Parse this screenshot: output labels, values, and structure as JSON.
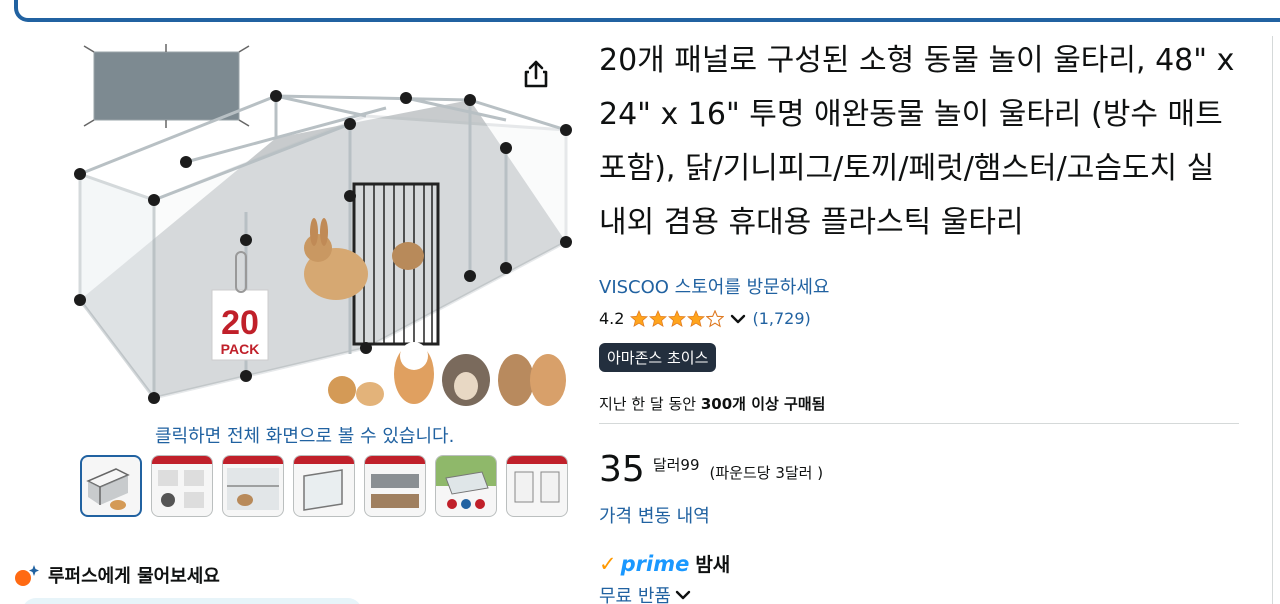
{
  "product": {
    "title": "20개 패널로 구성된 소형 동물 놀이 울타리, 48\" x 24\" x 16\" 투명 애완동물 놀이 울타리 (방수 매트 포함), 닭/기니피그/토끼/페럿/햄스터/고슴도치 실내외 겸용 휴대용 플라스틱 울타리",
    "store_link": "VISCOO 스토어를 방문하세요",
    "rating_value": "4.2",
    "rating_stars": 4.2,
    "rating_count": "(1,729)",
    "choice_badge": "아마존스 초이스",
    "bought_prefix": "지난 한 달 동안 ",
    "bought_bold": "300개 이상 구매됨",
    "price_whole": "35",
    "price_fraction": "달러99",
    "price_per_unit": "(파운드당 3달러 )",
    "price_history_link": "가격 변동 내역",
    "prime_label": "prime",
    "prime_delivery": "밤새",
    "returns_label": "무료 반품"
  },
  "gallery": {
    "zoom_hint": "클릭하면 전체 화면으로 볼 수 있습니다.",
    "pack_badge_number": "20",
    "pack_badge_text": "PACK",
    "thumbnail_count": 7,
    "selected_thumbnail": 0
  },
  "rufus": {
    "label": "루퍼스에게 물어보세요"
  },
  "colors": {
    "link": "#2162a1",
    "star": "#ffa41c",
    "badge_bg": "#232f3e",
    "prime": "#1a98ff",
    "prime_check": "#ff9900"
  },
  "icons": {
    "share": "share-icon",
    "chevron": "chevron-down-icon",
    "rufus": "rufus-sparkle-icon"
  }
}
